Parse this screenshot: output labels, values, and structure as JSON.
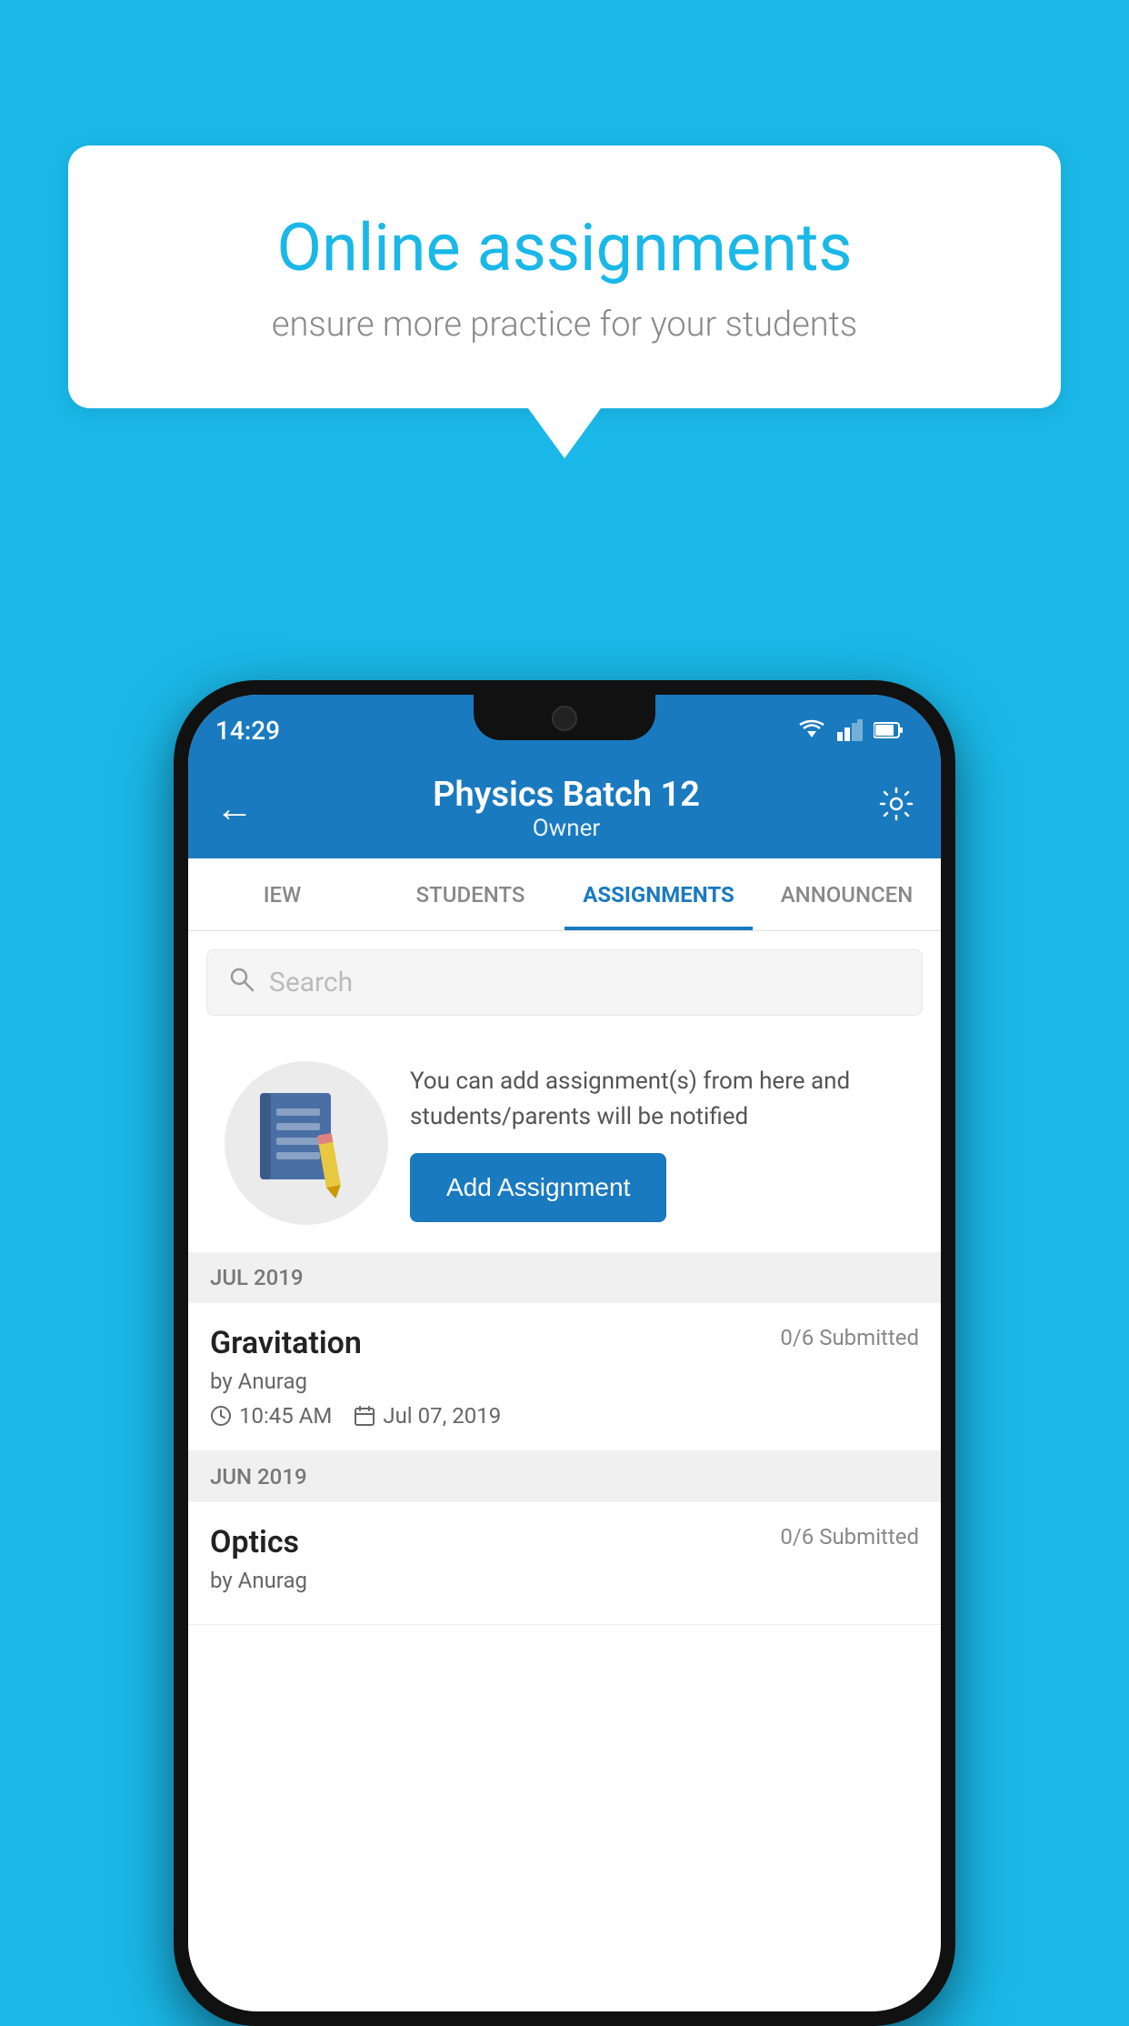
{
  "background": {
    "color": "#1ab8e8"
  },
  "speech_bubble": {
    "title": "Online assignments",
    "subtitle": "ensure more practice for your students"
  },
  "phone": {
    "status_bar": {
      "time": "14:29"
    },
    "header": {
      "title": "Physics Batch 12",
      "subtitle": "Owner",
      "back_label": "←",
      "settings_label": "⚙"
    },
    "tabs": [
      {
        "label": "IEW",
        "active": false
      },
      {
        "label": "STUDENTS",
        "active": false
      },
      {
        "label": "ASSIGNMENTS",
        "active": true
      },
      {
        "label": "ANNOUNCEN",
        "active": false
      }
    ],
    "search": {
      "placeholder": "Search"
    },
    "promo": {
      "description": "You can add assignment(s) from here and students/parents will be notified",
      "button_label": "Add Assignment"
    },
    "sections": [
      {
        "label": "JUL 2019",
        "assignments": [
          {
            "title": "Gravitation",
            "submitted": "0/6 Submitted",
            "author": "by Anurag",
            "time": "10:45 AM",
            "date": "Jul 07, 2019"
          }
        ]
      },
      {
        "label": "JUN 2019",
        "assignments": [
          {
            "title": "Optics",
            "submitted": "0/6 Submitted",
            "author": "by Anurag",
            "time": "",
            "date": ""
          }
        ]
      }
    ]
  }
}
